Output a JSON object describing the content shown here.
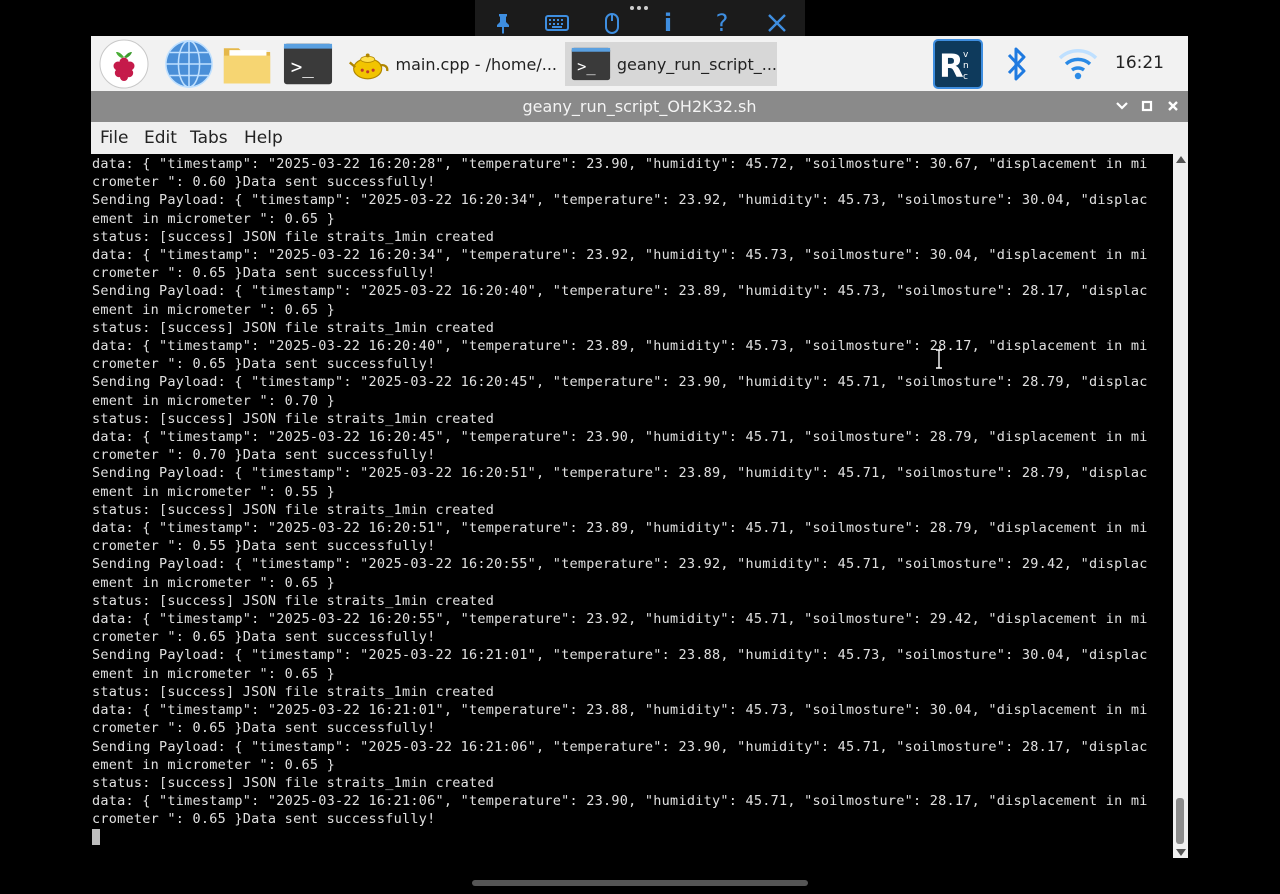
{
  "vnc_toolbar": {
    "icons": [
      "pin-icon",
      "keyboard-icon",
      "mouse-icon",
      "info-icon",
      "help-icon",
      "close-icon"
    ],
    "info_glyph": "i",
    "help_glyph": "?"
  },
  "taskbar": {
    "launchers": [
      "raspberry-menu-icon",
      "web-browser-icon",
      "file-manager-icon",
      "terminal-icon"
    ],
    "tasks": [
      {
        "label": "main.cpp - /home/...",
        "icon": "geany-icon",
        "active": false
      },
      {
        "label": "geany_run_script_...",
        "icon": "terminal-icon",
        "active": true
      }
    ],
    "tray": [
      "vnc-icon",
      "bluetooth-icon",
      "wifi-icon"
    ],
    "clock": "16:21"
  },
  "window": {
    "title": "geany_run_script_OH2K32.sh",
    "menu": [
      "File",
      "Edit",
      "Tabs",
      "Help"
    ]
  },
  "terminal": {
    "lines": [
      "data: { \"timestamp\": \"2025-03-22 16:20:28\", \"temperature\": 23.90, \"humidity\": 45.72, \"soilmosture\": 30.67, \"displacement in mi",
      "crometer \": 0.60 }Data sent successfully!",
      "Sending Payload: { \"timestamp\": \"2025-03-22 16:20:34\", \"temperature\": 23.92, \"humidity\": 45.73, \"soilmosture\": 30.04, \"displac",
      "ement in micrometer \": 0.65 }",
      "status: [success] JSON file straits_1min created",
      "data: { \"timestamp\": \"2025-03-22 16:20:34\", \"temperature\": 23.92, \"humidity\": 45.73, \"soilmosture\": 30.04, \"displacement in mi",
      "crometer \": 0.65 }Data sent successfully!",
      "Sending Payload: { \"timestamp\": \"2025-03-22 16:20:40\", \"temperature\": 23.89, \"humidity\": 45.73, \"soilmosture\": 28.17, \"displac",
      "ement in micrometer \": 0.65 }",
      "status: [success] JSON file straits_1min created",
      "data: { \"timestamp\": \"2025-03-22 16:20:40\", \"temperature\": 23.89, \"humidity\": 45.73, \"soilmosture\": 28.17, \"displacement in mi",
      "crometer \": 0.65 }Data sent successfully!",
      "Sending Payload: { \"timestamp\": \"2025-03-22 16:20:45\", \"temperature\": 23.90, \"humidity\": 45.71, \"soilmosture\": 28.79, \"displac",
      "ement in micrometer \": 0.70 }",
      "status: [success] JSON file straits_1min created",
      "data: { \"timestamp\": \"2025-03-22 16:20:45\", \"temperature\": 23.90, \"humidity\": 45.71, \"soilmosture\": 28.79, \"displacement in mi",
      "crometer \": 0.70 }Data sent successfully!",
      "Sending Payload: { \"timestamp\": \"2025-03-22 16:20:51\", \"temperature\": 23.89, \"humidity\": 45.71, \"soilmosture\": 28.79, \"displac",
      "ement in micrometer \": 0.55 }",
      "status: [success] JSON file straits_1min created",
      "data: { \"timestamp\": \"2025-03-22 16:20:51\", \"temperature\": 23.89, \"humidity\": 45.71, \"soilmosture\": 28.79, \"displacement in mi",
      "crometer \": 0.55 }Data sent successfully!",
      "Sending Payload: { \"timestamp\": \"2025-03-22 16:20:55\", \"temperature\": 23.92, \"humidity\": 45.71, \"soilmosture\": 29.42, \"displac",
      "ement in micrometer \": 0.65 }",
      "status: [success] JSON file straits_1min created",
      "data: { \"timestamp\": \"2025-03-22 16:20:55\", \"temperature\": 23.92, \"humidity\": 45.71, \"soilmosture\": 29.42, \"displacement in mi",
      "crometer \": 0.65 }Data sent successfully!",
      "Sending Payload: { \"timestamp\": \"2025-03-22 16:21:01\", \"temperature\": 23.88, \"humidity\": 45.73, \"soilmosture\": 30.04, \"displac",
      "ement in micrometer \": 0.65 }",
      "status: [success] JSON file straits_1min created",
      "data: { \"timestamp\": \"2025-03-22 16:21:01\", \"temperature\": 23.88, \"humidity\": 45.73, \"soilmosture\": 30.04, \"displacement in mi",
      "crometer \": 0.65 }Data sent successfully!",
      "Sending Payload: { \"timestamp\": \"2025-03-22 16:21:06\", \"temperature\": 23.90, \"humidity\": 45.71, \"soilmosture\": 28.17, \"displac",
      "ement in micrometer \": 0.65 }",
      "status: [success] JSON file straits_1min created",
      "data: { \"timestamp\": \"2025-03-22 16:21:06\", \"temperature\": 23.90, \"humidity\": 45.71, \"soilmosture\": 28.17, \"displacement in mi",
      "crometer \": 0.65 }Data sent successfully!"
    ]
  },
  "colors": {
    "accent": "#3e8ee0",
    "titlebar": "#8a8a8a",
    "taskbar": "#f2f2f2",
    "terminal_bg": "#000000",
    "terminal_fg": "#e0e0e0"
  }
}
